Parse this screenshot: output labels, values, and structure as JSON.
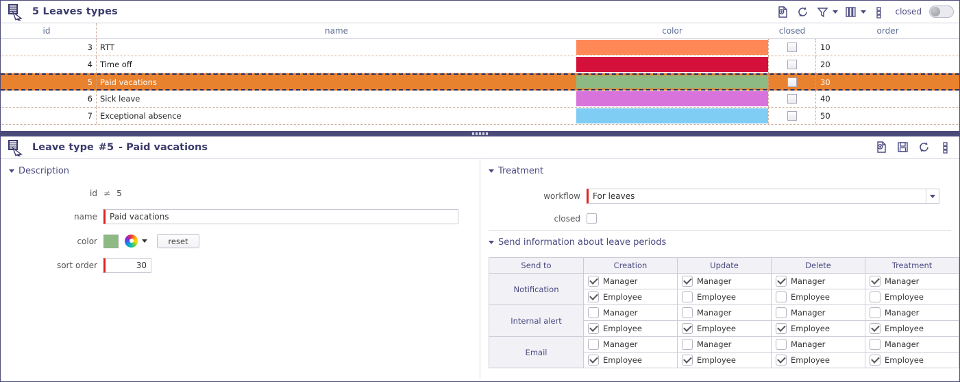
{
  "grid": {
    "title": "5 Leaves types",
    "toolbar": {
      "add_icon": "add-page-icon",
      "refresh_icon": "refresh-icon",
      "filter_icon": "filter-icon",
      "columns_icon": "columns-icon",
      "more_icon": "more-options-icon",
      "closed_label": "closed",
      "toggle_state": "off"
    },
    "columns": [
      "id",
      "name",
      "color",
      "closed",
      "order"
    ],
    "rows": [
      {
        "id": "3",
        "name": "RTT",
        "color": "#FF8856",
        "closed": false,
        "order": "10",
        "selected": false
      },
      {
        "id": "4",
        "name": "Time off",
        "color": "#D4103B",
        "closed": false,
        "order": "20",
        "selected": false
      },
      {
        "id": "5",
        "name": "Paid vacations",
        "color": "#8DBA82",
        "closed": false,
        "order": "30",
        "selected": true
      },
      {
        "id": "6",
        "name": "Sick leave",
        "color": "#D873DC",
        "closed": false,
        "order": "40",
        "selected": false
      },
      {
        "id": "7",
        "name": "Exceptional absence",
        "color": "#7FCCF5",
        "closed": false,
        "order": "50",
        "selected": false
      }
    ]
  },
  "detail": {
    "title": "Leave type",
    "record_id": "#5",
    "record_name": "- Paid vacations",
    "toolbar": {
      "add_icon": "add-page-icon",
      "save_icon": "save-icon",
      "refresh_icon": "refresh-icon",
      "more_icon": "more-options-icon"
    },
    "description": {
      "section_label": "Description",
      "id_label": "id",
      "id_symbol": "≠",
      "id_value": "5",
      "name_label": "name",
      "name_value": "Paid vacations",
      "color_label": "color",
      "color_value": "#8DBA82",
      "reset_label": "reset",
      "sort_order_label": "sort order",
      "sort_order_value": "30"
    },
    "treatment": {
      "section_label": "Treatment",
      "workflow_label": "workflow",
      "workflow_value": "For leaves",
      "closed_label": "closed",
      "closed_checked": false
    },
    "send_info": {
      "section_label": "Send information about leave periods",
      "columns": [
        "Send to",
        "Creation",
        "Update",
        "Delete",
        "Treatment"
      ],
      "target_labels": [
        "Manager",
        "Employee"
      ],
      "rows": [
        {
          "label": "Notification",
          "creation": [
            true,
            true
          ],
          "update": [
            true,
            false
          ],
          "delete": [
            true,
            false
          ],
          "treatment": [
            true,
            false
          ]
        },
        {
          "label": "Internal alert",
          "creation": [
            false,
            true
          ],
          "update": [
            false,
            true
          ],
          "delete": [
            false,
            true
          ],
          "treatment": [
            false,
            true
          ]
        },
        {
          "label": "Email",
          "creation": [
            false,
            true
          ],
          "update": [
            false,
            true
          ],
          "delete": [
            false,
            true
          ],
          "treatment": [
            false,
            true
          ]
        }
      ]
    }
  }
}
